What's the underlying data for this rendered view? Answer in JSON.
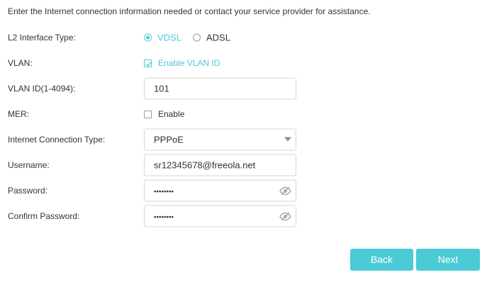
{
  "intro_text": "Enter the Internet connection information needed or contact your service provider for assistance.",
  "l2_interface": {
    "label": "L2 Interface Type:",
    "options": [
      {
        "label": "VDSL",
        "selected": true
      },
      {
        "label": "ADSL",
        "selected": false
      }
    ]
  },
  "vlan": {
    "label": "VLAN:",
    "checkbox_label": "Enable VLAN ID",
    "checked": true
  },
  "vlan_id": {
    "label": "VLAN ID(1-4094):",
    "value": "101"
  },
  "mer": {
    "label": "MER:",
    "checkbox_label": "Enable",
    "checked": false
  },
  "connection_type": {
    "label": "Internet Connection Type:",
    "value": "PPPoE"
  },
  "username": {
    "label": "Username:",
    "value": "sr12345678@freeola.net"
  },
  "password": {
    "label": "Password:",
    "masked_value": "••••••••",
    "eye_icon": "eye-slash-icon"
  },
  "confirm_password": {
    "label": "Confirm Password:",
    "masked_value": "••••••••",
    "eye_icon": "eye-slash-icon"
  },
  "buttons": {
    "back": "Back",
    "next": "Next"
  },
  "colors": {
    "accent": "#4acbd6",
    "text": "#333333",
    "border": "#d6d6d6"
  }
}
